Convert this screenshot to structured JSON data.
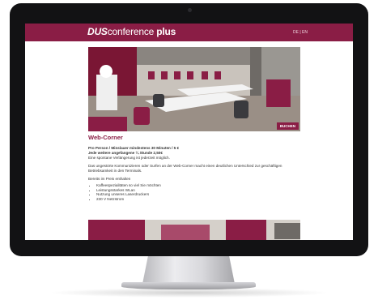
{
  "site": {
    "logo_dus": "DUS",
    "logo_conference": "conference",
    "logo_plus": " plus",
    "language_switch": "DE | EN"
  },
  "hero": {
    "book_label": "BUCHEN"
  },
  "section": {
    "title": "Web-Corner",
    "price_line1": "Pro Person / Minslauer mindestens 30 Minuten / 5 €",
    "price_line2": "Jede weitere angefangene ¼ Stunde 2,50€",
    "note": "Eine spontane Verlängerung ist jederzeit möglich.",
    "description": "Das ungestörte Kommunizieren oder Surfen an der Web-Corner macht einen deutlichen Unterschied zur geschäftigen Betriebsamkeit in den Terminals.",
    "included_heading": "Bereits im Preis enthalten",
    "included_items": [
      "Kaffeespezialitäten so viel Sie möchten",
      "Leistungsstarkes WLan",
      "Nutzung unseres Laserdruckers",
      "230 V Netzstrom"
    ]
  },
  "colors": {
    "brand": "#8a1d45",
    "bezel": "#121214"
  }
}
